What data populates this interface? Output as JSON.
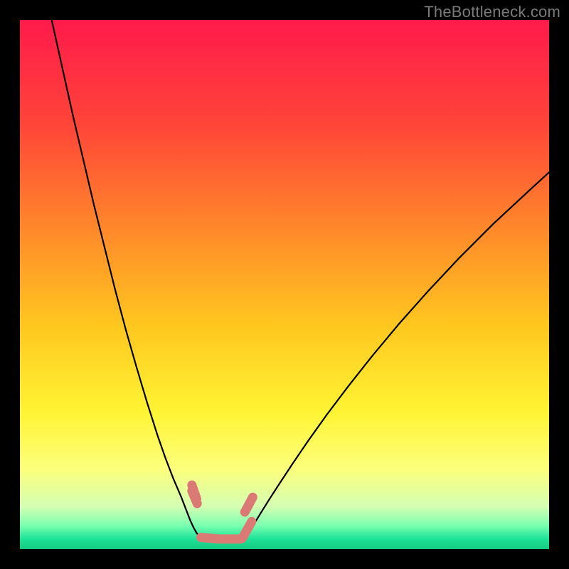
{
  "watermark": "TheBottleneck.com",
  "chart_data": {
    "type": "line",
    "title": "",
    "xlabel": "",
    "ylabel": "",
    "xlim": [
      0,
      100
    ],
    "ylim": [
      0,
      100
    ],
    "grid": false,
    "legend": false,
    "background_gradient": {
      "stops": [
        {
          "pos": 0.0,
          "color": "#ff1a4b"
        },
        {
          "pos": 0.2,
          "color": "#ff4538"
        },
        {
          "pos": 0.4,
          "color": "#ff8a2a"
        },
        {
          "pos": 0.58,
          "color": "#ffc81f"
        },
        {
          "pos": 0.74,
          "color": "#fff433"
        },
        {
          "pos": 0.85,
          "color": "#fcff7d"
        },
        {
          "pos": 0.92,
          "color": "#d4ffb3"
        },
        {
          "pos": 0.955,
          "color": "#7cffb0"
        },
        {
          "pos": 0.98,
          "color": "#1fe59a"
        },
        {
          "pos": 1.0,
          "color": "#15c87f"
        }
      ]
    },
    "series": [
      {
        "name": "curve-left",
        "color": "#000000",
        "x": [
          6,
          8,
          10,
          12,
          14,
          16,
          18,
          20,
          22,
          24,
          26,
          27.5,
          29,
          30.5,
          31.5,
          32.2,
          32.8,
          33.3,
          33.7,
          34.0
        ],
        "y": [
          100,
          91,
          82,
          73.5,
          65,
          57,
          49,
          41.5,
          34.5,
          27.8,
          21.5,
          17.2,
          13.3,
          9.8,
          7.2,
          5.4,
          4.1,
          3.2,
          2.6,
          2.1
        ]
      },
      {
        "name": "curve-right",
        "color": "#000000",
        "x": [
          42.5,
          43.0,
          43.6,
          44.4,
          45.5,
          47.0,
          49.0,
          51.5,
          54.5,
          58.0,
          62.0,
          66.5,
          71.5,
          77.0,
          83.0,
          89.5,
          96.5,
          100.0
        ],
        "y": [
          2.2,
          2.8,
          3.7,
          5.0,
          6.8,
          9.2,
          12.3,
          16.1,
          20.5,
          25.4,
          30.7,
          36.4,
          42.4,
          48.6,
          55.0,
          61.5,
          68.0,
          71.2
        ]
      },
      {
        "name": "marker-segments",
        "color": "#db7a74",
        "segments": [
          {
            "x0": 33.4,
            "y0": 9.5,
            "x1": 32.5,
            "y1": 12.1
          },
          {
            "x0": 33.5,
            "y0": 8.6,
            "x1": 32.5,
            "y1": 11.0
          },
          {
            "x0": 34.2,
            "y0": 2.2,
            "x1": 37.6,
            "y1": 1.9
          },
          {
            "x0": 38.0,
            "y0": 1.9,
            "x1": 41.6,
            "y1": 1.9
          },
          {
            "x0": 42.0,
            "y0": 2.0,
            "x1": 43.8,
            "y1": 5.2
          },
          {
            "x0": 42.5,
            "y0": 7.0,
            "x1": 44.0,
            "y1": 9.8
          }
        ]
      }
    ]
  }
}
